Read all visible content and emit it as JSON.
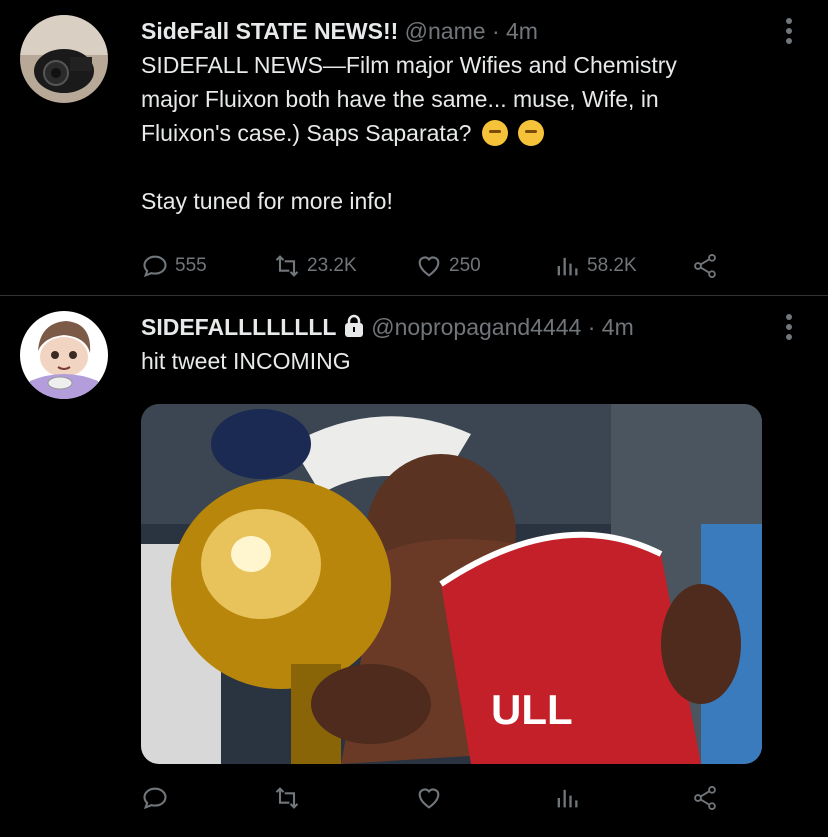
{
  "tweets": [
    {
      "display_name": "SideFall STATE NEWS!!",
      "handle": "@name",
      "time": "· 4m",
      "text_line1": "SIDEFALL NEWS—Film major Wifies and Chemistry",
      "text_line2": "major Fluixon both have the same... muse, Wife, in",
      "text_line3": "Fluixon's case.) Saps Saparata?",
      "text_line4": "Stay tuned for more info!",
      "emoji": "thinking-face-icon",
      "replies": "555",
      "retweets": "23.2K",
      "likes": "250",
      "views": "58.2K"
    },
    {
      "display_name": "SIDEFALLLLLLLL",
      "handle": "@nopropagand4444",
      "time": "· 4m",
      "text_line1": "hit tweet INCOMING",
      "media_icon": "photo-basketball-player-with-trophy"
    }
  ],
  "colors": {
    "background": "#000000",
    "text": "#e7e9ea",
    "muted": "#71767b",
    "divider": "#2f3336"
  }
}
